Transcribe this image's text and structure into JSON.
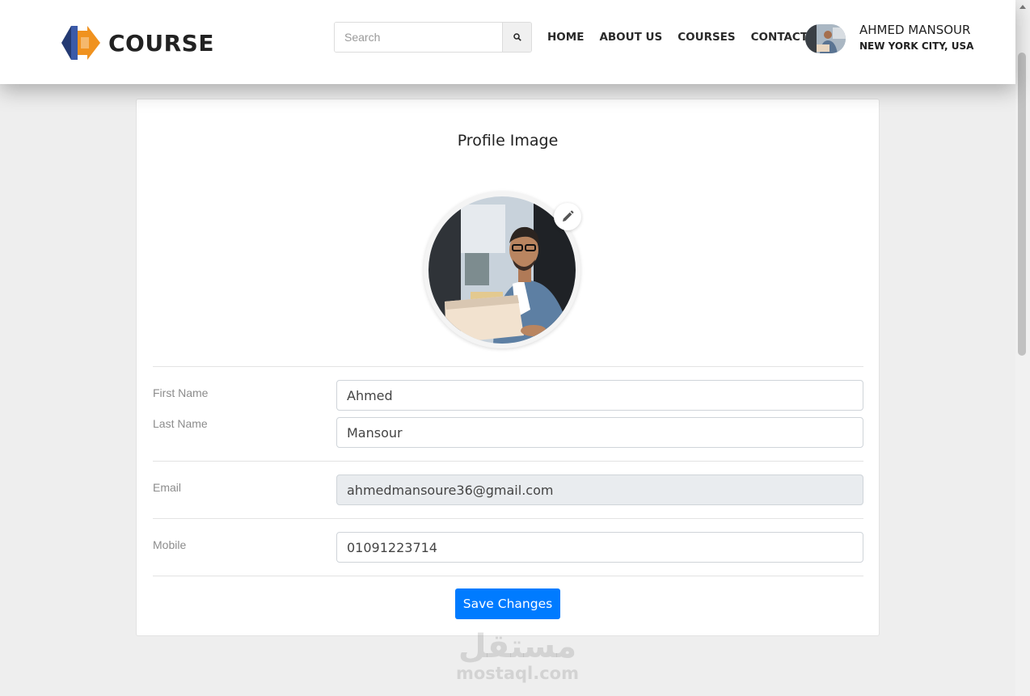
{
  "brand": {
    "name": "COURSE",
    "colors": {
      "orange": "#f0921f",
      "navy": "#243a73"
    }
  },
  "search": {
    "placeholder": "Search",
    "icon": "search-icon"
  },
  "nav": [
    {
      "label": "HOME"
    },
    {
      "label": "ABOUT US"
    },
    {
      "label": "COURSES"
    },
    {
      "label": "CONTACT"
    }
  ],
  "user": {
    "name": "AHMED MANSOUR",
    "location": "NEW YORK CITY, USA"
  },
  "profile": {
    "title": "Profile Image",
    "edit_icon": "pencil-icon",
    "fields": {
      "first_name": {
        "label": "First Name",
        "value": "Ahmed"
      },
      "last_name": {
        "label": "Last Name",
        "value": "Mansour"
      },
      "email": {
        "label": "Email",
        "value": "ahmedmansoure36@gmail.com"
      },
      "mobile": {
        "label": "Mobile",
        "value": "01091223714"
      }
    },
    "save_label": "Save Changes"
  },
  "watermark": {
    "arabic": "مستقل",
    "latin": "mostaql.com"
  },
  "colors": {
    "primary": "#007bff",
    "readonly_bg": "#e9ecef",
    "page_bg": "#eeeeee"
  }
}
